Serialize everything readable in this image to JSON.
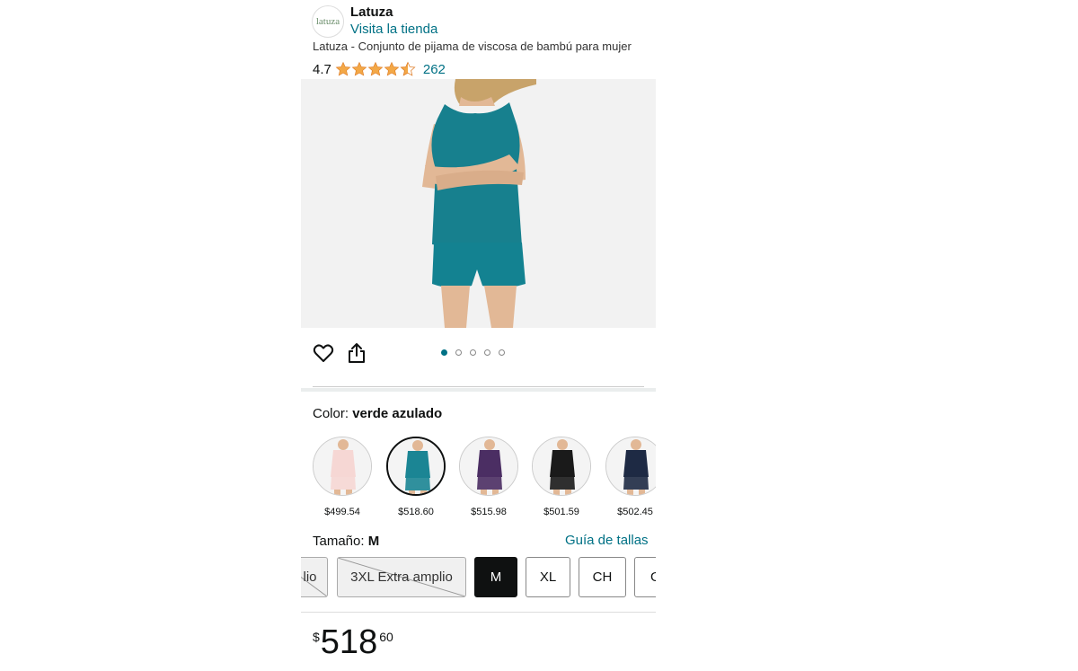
{
  "header": {
    "logo_text": "latuza",
    "brand": "Latuza",
    "store_link": "Visita la tienda",
    "title": "Latuza - Conjunto de pijama de viscosa de bambú para mujer"
  },
  "rating": {
    "value": "4.7",
    "stars": 4.5,
    "count": "262",
    "color": "#f3a847"
  },
  "gallery": {
    "dots": 5,
    "active_index": 0
  },
  "color_section": {
    "label": "Color:",
    "selected": "verde azulado",
    "swatches": [
      {
        "price": "$499.54",
        "color": "#f6d7d4"
      },
      {
        "price": "$518.60",
        "color": "#1b8594"
      },
      {
        "price": "$515.98",
        "color": "#4b2e63"
      },
      {
        "price": "$501.59",
        "color": "#1a1a1a"
      },
      {
        "price": "$502.45",
        "color": "#1e2a44"
      }
    ]
  },
  "size_section": {
    "label": "Tamaño:",
    "selected": "M",
    "guide_link": "Guía de tallas",
    "sizes": [
      "lio",
      "3XL Extra amplio",
      "M",
      "XL",
      "CH",
      "G"
    ]
  },
  "price": {
    "symbol": "$",
    "whole": "518",
    "fraction": "60"
  },
  "colors": {
    "accent_link": "#007185",
    "star": "#f3a847",
    "product": "#17808e"
  }
}
